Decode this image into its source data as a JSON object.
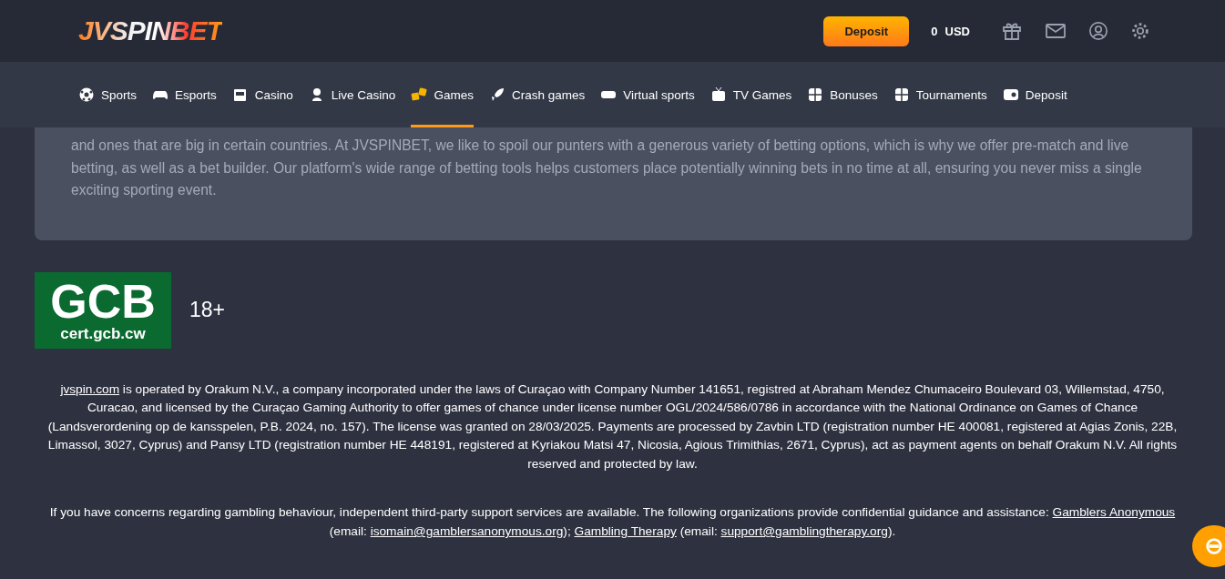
{
  "header": {
    "logo": "JVSPINBET",
    "deposit_button": "Deposit",
    "balance": "0",
    "currency": "USD"
  },
  "nav": [
    {
      "label": "Sports",
      "selected": false
    },
    {
      "label": "Esports",
      "selected": false
    },
    {
      "label": "Casino",
      "selected": false
    },
    {
      "label": "Live Casino",
      "selected": false
    },
    {
      "label": "Games",
      "selected": true
    },
    {
      "label": "Crash games",
      "selected": false
    },
    {
      "label": "Virtual sports",
      "selected": false
    },
    {
      "label": "TV Games",
      "selected": false
    },
    {
      "label": "Bonuses",
      "selected": false
    },
    {
      "label": "Tournaments",
      "selected": false
    },
    {
      "label": "Deposit",
      "selected": false
    }
  ],
  "seo_text": "and ones that are big in certain countries. At JVSPINBET, we like to spoil our punters with a generous variety of betting options, which is why we offer pre-match and live betting, as well as a bet builder. Our platform's wide range of betting tools helps customers place potentially winning bets in no time at all, ensuring you never miss a single exciting sporting event.",
  "license_badge": {
    "title": "GCB",
    "url": "cert.gcb.cw"
  },
  "age_limit": "18+",
  "legal": [
    [
      {
        "text": "jvspin.com",
        "link": true
      },
      {
        "text": " is operated by Orakum N.V., a company incorporated under the laws of Curaçao with Company Number 141651, registred at Abraham Mendez Chumaceiro Boulevard 03, Willemstad, 4750, Curacao, and licensed by the Curaçao Gaming Authority to offer games of chance under license number OGL/2024/586/0786 in accordance with the National Ordinance on Games of Chance (Landsverordening op de kansspelen, P.B. 2024, no. 157). The license was granted on 28/03/2025. Payments are processed by Zavbin LTD (registration number HE 400081, registered at Agias Zonis, 22B, Limassol, 3027, Cyprus) and Pansy LTD (registration number HE 448191, registered at Kyriakou Matsi 47, Nicosia, Agious Trimithias, 2671, Cyprus), act as payment agents on behalf Orakum N.V. All rights reserved and protected by law.",
        "link": false
      }
    ],
    [
      {
        "text": "If you have concerns regarding gambling behaviour, independent third-party support services are available. The following organizations provide confidential guidance and assistance: ",
        "link": false
      },
      {
        "text": "Gamblers Anonymous",
        "link": true
      },
      {
        "text": " (email: ",
        "link": false
      },
      {
        "text": "isomain@gamblersanonymous.org",
        "link": true
      },
      {
        "text": "); ",
        "link": false
      },
      {
        "text": "Gambling Therapy",
        "link": true
      },
      {
        "text": " (email: ",
        "link": false
      },
      {
        "text": "support@gamblingtherapy.org",
        "link": true
      },
      {
        "text": ").",
        "link": false
      }
    ]
  ]
}
